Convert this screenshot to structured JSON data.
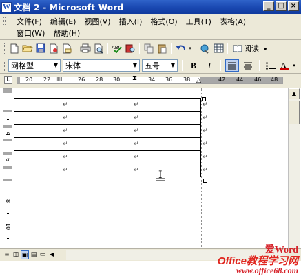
{
  "window": {
    "icon_label": "W",
    "title": "文档 2 - Microsoft Word",
    "buttons": [
      "_",
      "□",
      "×"
    ]
  },
  "menu": {
    "row1": [
      "文件(F)",
      "编辑(E)",
      "视图(V)",
      "插入(I)",
      "格式(O)",
      "工具(T)",
      "表格(A)"
    ],
    "row2": [
      "窗口(W)",
      "帮助(H)"
    ]
  },
  "standard_toolbar": {
    "icons": [
      "new-icon",
      "open-icon",
      "save-icon",
      "permission-icon",
      "email-icon",
      "print-icon",
      "print-preview-icon",
      "spelling-icon",
      "research-icon",
      "copy-icon",
      "paste-icon",
      "undo-icon",
      "hyperlink-icon",
      "table-icon"
    ],
    "reading_label": "阅读"
  },
  "format_toolbar": {
    "style": "网格型",
    "font": "宋体",
    "size": "五号",
    "bold": "B",
    "italic": "I"
  },
  "ruler": {
    "corner": "L",
    "numbers": [
      "20",
      "22",
      "26",
      "28",
      "30",
      "34",
      "36",
      "38",
      "42",
      "44",
      "46",
      "48"
    ]
  },
  "vertical_ruler": {
    "numbers": [
      "4",
      "6",
      "8",
      "10"
    ]
  },
  "table": {
    "rows": 6,
    "cell_mark": "↵",
    "end_mark": "↵"
  },
  "view_buttons": [
    "≡",
    "◫",
    "▣",
    "▤",
    "▭"
  ],
  "watermark": {
    "top": "爱Word",
    "middle": "Office教程学习网",
    "url": "www.office68.com"
  }
}
